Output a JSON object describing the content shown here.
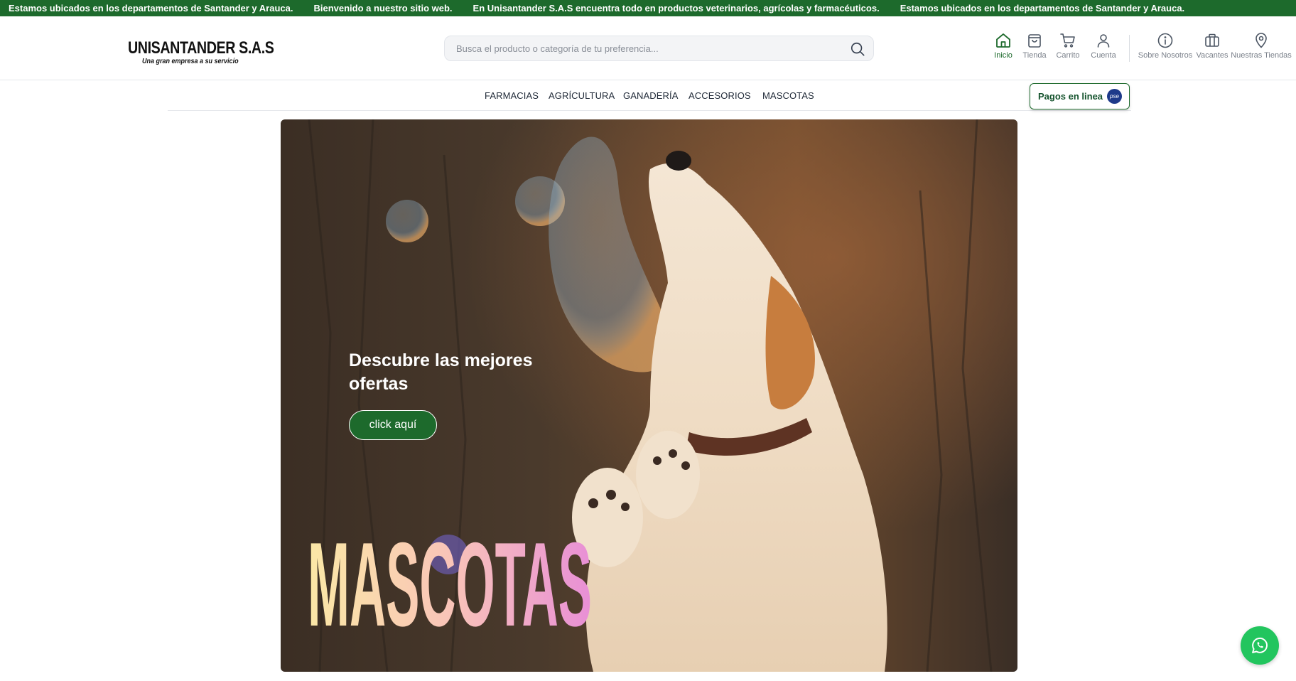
{
  "ticker": {
    "items": [
      "Estamos ubicados en los departamentos de Santander y Arauca.",
      "Bienvenido a nuestro sitio web.",
      "En Unisantander S.A.S encuentra todo en productos veterinarios, agrícolas y farmacéuticos.",
      "Estamos ubicados en los departamentos de Santander y Arauca."
    ]
  },
  "brand": {
    "name": "UNISANTANDER S.A.S",
    "tagline": "Una gran empresa a su servicio",
    "primary_color": "#1d6a2c"
  },
  "search": {
    "placeholder": "Busca el producto o categoría de tu preferencia...",
    "value": ""
  },
  "nav": {
    "items": [
      {
        "label": "Inicio",
        "icon": "home-icon",
        "active": true
      },
      {
        "label": "Tienda",
        "icon": "shopping-bag-icon"
      },
      {
        "label": "Carrito",
        "icon": "cart-icon"
      },
      {
        "label": "Cuenta",
        "icon": "user-icon"
      },
      {
        "label": "Sobre Nosotros",
        "icon": "info-icon"
      },
      {
        "label": "Vacantes",
        "icon": "briefcase-icon"
      },
      {
        "label": "Nuestras Tiendas",
        "icon": "map-pin-icon"
      }
    ]
  },
  "categories": [
    "FARMACIAS",
    "AGRÍCULTURA",
    "GANADERÍA",
    "ACCESORIOS",
    "MASCOTAS"
  ],
  "payments": {
    "label": "Pagos en linea",
    "badge": "pse"
  },
  "hero": {
    "heading": "Descubre las mejores ofertas",
    "button": "click aquí",
    "word": "MASCOTAS"
  },
  "whatsapp": {
    "icon": "whatsapp-icon",
    "color": "#22c55e"
  }
}
